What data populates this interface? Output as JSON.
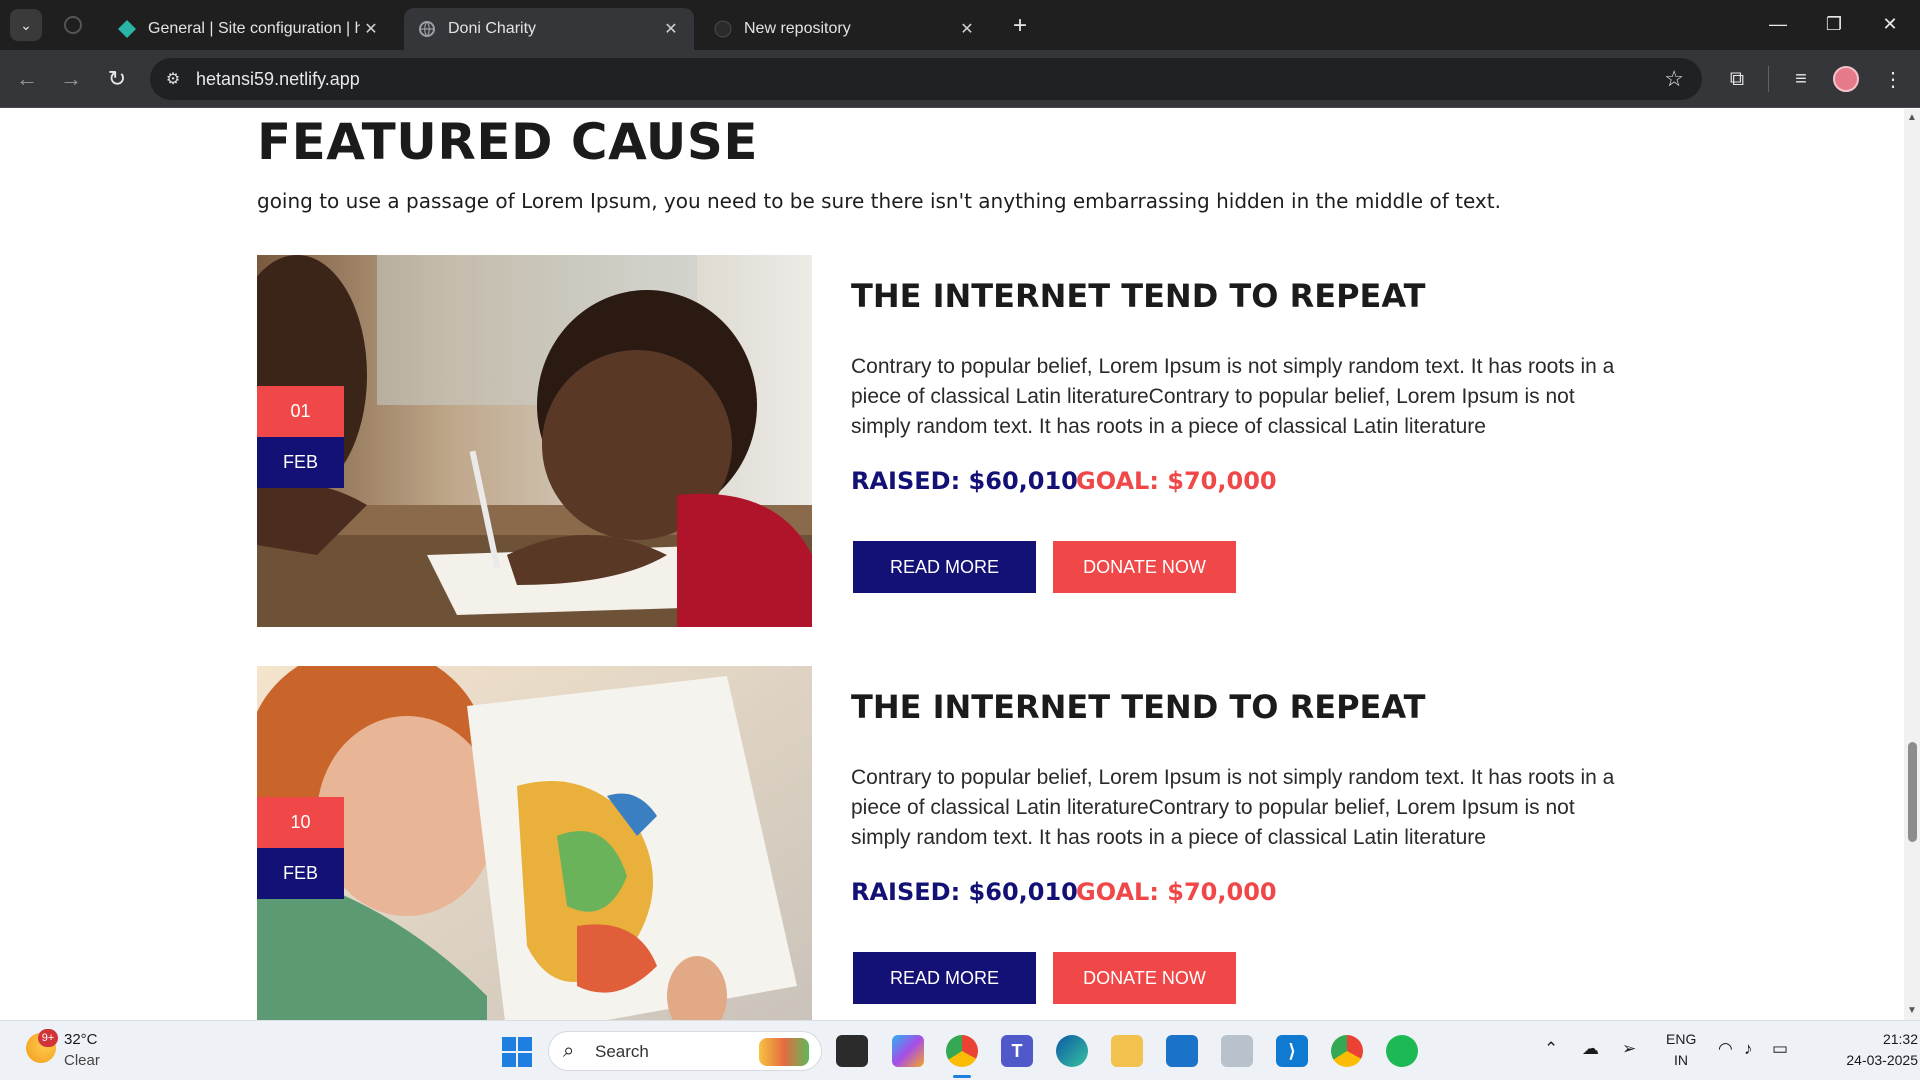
{
  "browser": {
    "tabs": [
      {
        "title": "General | Site configuration | he",
        "close": "✕",
        "active": false
      },
      {
        "title": "Doni Charity",
        "close": "✕",
        "active": true
      },
      {
        "title": "New repository",
        "close": "✕",
        "active": false
      }
    ],
    "new_tab": "+",
    "url": "hetansi59.netlify.app",
    "window_controls": {
      "minimize": "—",
      "restore": "❐",
      "close": "✕"
    }
  },
  "page": {
    "section_title": "FEATURED CAUSE",
    "section_subtitle": "going to use a passage of Lorem Ipsum, you need to be sure there isn't anything embarrassing hidden in the middle of text.",
    "causes": [
      {
        "date_day": "01",
        "date_month": "FEB",
        "title": "THE INTERNET TEND TO REPEAT",
        "description": "Contrary to popular belief, Lorem Ipsum is not simply random text. It has roots in a piece of classical Latin literatureContrary to popular belief, Lorem Ipsum is not simply random text. It has roots in a piece of classical Latin literature",
        "raised": "RAISED: $60,010",
        "goal": "GOAL: $70,000",
        "read_more": "READ MORE",
        "donate_now": "DONATE NOW",
        "image": "student-writing-photo"
      },
      {
        "date_day": "10",
        "date_month": "FEB",
        "title": "THE INTERNET TEND TO REPEAT",
        "description": "Contrary to popular belief, Lorem Ipsum is not simply random text. It has roots in a piece of classical Latin literatureContrary to popular belief, Lorem Ipsum is not simply random text. It has roots in a piece of classical Latin literature",
        "raised": "RAISED: $60,010",
        "goal": "GOAL: $70,000",
        "read_more": "READ MORE",
        "donate_now": "DONATE NOW",
        "image": "child-reading-map-photo"
      }
    ],
    "colors": {
      "navy": "#131175",
      "coral": "#f04848"
    }
  },
  "taskbar": {
    "weather": {
      "temp": "32°C",
      "condition": "Clear",
      "badge": "9+"
    },
    "search_label": "Search",
    "language": {
      "line1": "ENG",
      "line2": "IN"
    },
    "time": "21:32",
    "date": "24-03-2025"
  }
}
